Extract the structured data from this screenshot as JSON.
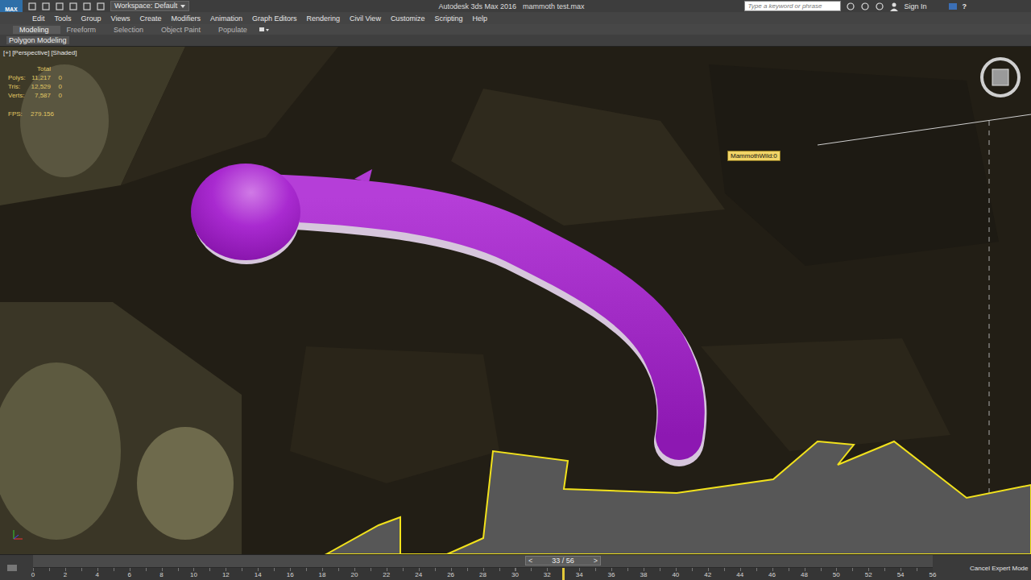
{
  "window": {
    "title": "Autodesk 3ds Max 2016",
    "file": "mammoth test.max"
  },
  "logo": "MAX",
  "workspace": "Workspace: Default",
  "search": {
    "placeholder": "Type a keyword or phrase"
  },
  "account": "Sign In",
  "help": "?",
  "menu": [
    "Edit",
    "Tools",
    "Group",
    "Views",
    "Create",
    "Modifiers",
    "Animation",
    "Graph Editors",
    "Rendering",
    "Civil View",
    "Customize",
    "Scripting",
    "Help"
  ],
  "ribbon_tabs": [
    {
      "label": "Modeling",
      "selected": true
    },
    {
      "label": "Freeform",
      "selected": false
    },
    {
      "label": "Selection",
      "selected": false
    },
    {
      "label": "Object Paint",
      "selected": false
    },
    {
      "label": "Populate",
      "selected": false
    }
  ],
  "ribbon_panel": "Polygon Modeling",
  "viewport": {
    "labels": [
      "[+]",
      "[Perspective]",
      "[Shaded]"
    ],
    "stats": {
      "header": "Total",
      "rows": [
        {
          "label": "Polys:",
          "total": "11,217",
          "selected": "0"
        },
        {
          "label": "Tris:",
          "total": "12,529",
          "selected": "0"
        },
        {
          "label": "Verts:",
          "total": "7,587",
          "selected": "0"
        }
      ],
      "fps_label": "FPS:",
      "fps": "279.156"
    },
    "tooltip": "MammothWild:0"
  },
  "timeline": {
    "frame": "33 / 56",
    "prev": "<",
    "next": ">",
    "level": 0.589,
    "ticks": [
      "0",
      "2",
      "4",
      "6",
      "8",
      "10",
      "12",
      "14",
      "16",
      "18",
      "20",
      "22",
      "24",
      "26",
      "28",
      "30",
      "32",
      "34",
      "36",
      "38",
      "40",
      "42",
      "44",
      "46",
      "48",
      "50",
      "52",
      "54",
      "56"
    ]
  },
  "status": {
    "expert": "Cancel Expert Mode"
  }
}
